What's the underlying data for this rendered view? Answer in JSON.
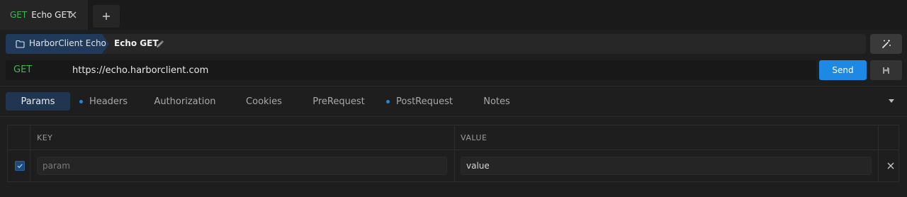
{
  "tab": {
    "method": "GET",
    "name": "Echo GET"
  },
  "breadcrumb": {
    "folder": "HarborClient Echo",
    "request": "Echo GET"
  },
  "request": {
    "method": "GET",
    "url": "https://echo.harborclient.com",
    "send_label": "Send"
  },
  "subtabs": [
    {
      "label": "Params",
      "active": true,
      "dot": false
    },
    {
      "label": "Headers",
      "active": false,
      "dot": true
    },
    {
      "label": "Authorization",
      "active": false,
      "dot": false
    },
    {
      "label": "Cookies",
      "active": false,
      "dot": false
    },
    {
      "label": "PreRequest",
      "active": false,
      "dot": false
    },
    {
      "label": "PostRequest",
      "active": false,
      "dot": true
    },
    {
      "label": "Notes",
      "active": false,
      "dot": false
    }
  ],
  "params": {
    "columns": {
      "key": "KEY",
      "value": "VALUE"
    },
    "rows": [
      {
        "checked": true,
        "key": "",
        "key_placeholder": "param",
        "value": "value"
      }
    ]
  },
  "colors": {
    "accent": "#1e88e5",
    "method_get": "#3fb950",
    "background": "#1e1e1e",
    "active_tab": "#1f3550"
  }
}
